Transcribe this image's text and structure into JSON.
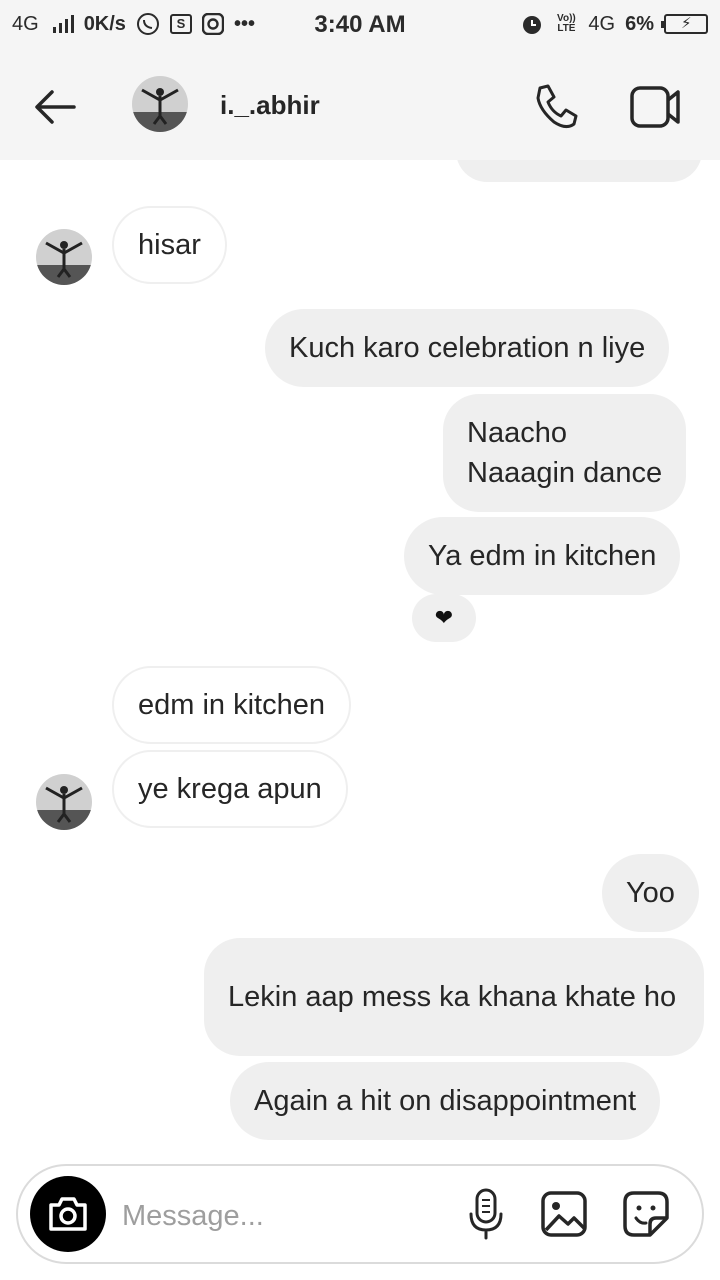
{
  "status_bar": {
    "network_left": "4G",
    "speed": "0K/s",
    "time": "3:40 AM",
    "volte": "Vo)) LTE",
    "network_right": "4G",
    "battery": "6%",
    "more": "•••",
    "s_box": "S",
    "icons": [
      "signal-icon",
      "whatsapp-icon",
      "screenshot-icon",
      "instagram-icon",
      "alarm-icon",
      "battery-icon"
    ]
  },
  "header": {
    "username": "i._.abhir",
    "icons": [
      "back-arrow-icon",
      "phone-icon",
      "video-camera-icon"
    ]
  },
  "messages": [
    {
      "side": "in",
      "text": "hisar"
    },
    {
      "side": "out",
      "text": "Kuch karo celebration n liye"
    },
    {
      "side": "out",
      "text": "Naacho\nNaaagin dance"
    },
    {
      "side": "out",
      "text": "Ya edm in kitchen"
    },
    {
      "side": "in",
      "text": "edm in kitchen"
    },
    {
      "side": "in",
      "text": "ye krega apun"
    },
    {
      "side": "out",
      "text": "Yoo"
    },
    {
      "side": "out",
      "text": "Lekin aap mess ka khana khate ho"
    },
    {
      "side": "out",
      "text": "Again a hit on disappointment"
    }
  ],
  "reaction": "❤",
  "composer": {
    "placeholder": "Message...",
    "icons": [
      "camera-icon",
      "microphone-icon",
      "gallery-icon",
      "sticker-icon"
    ]
  },
  "colors": {
    "header_bg": "#f5f5f5",
    "outgoing_bubble": "#efefef",
    "incoming_border": "#efefef",
    "placeholder": "#9e9e9e"
  }
}
